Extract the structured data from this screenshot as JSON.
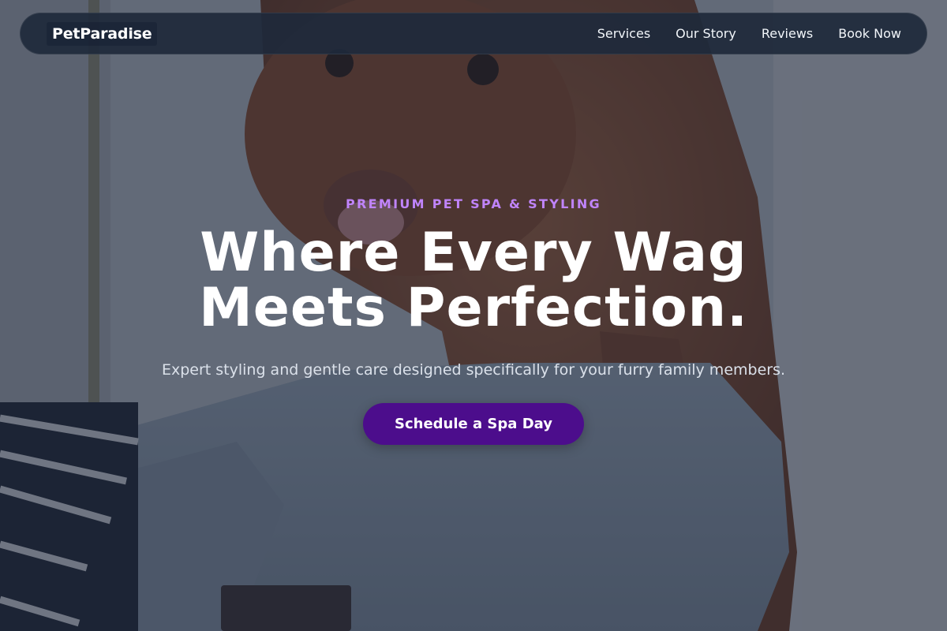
{
  "brand": {
    "name": "PetParadise"
  },
  "nav": {
    "links": [
      {
        "label": "Services"
      },
      {
        "label": "Our Story"
      },
      {
        "label": "Reviews"
      },
      {
        "label": "Book Now"
      }
    ]
  },
  "hero": {
    "eyebrow": "PREMIUM PET SPA & STYLING",
    "headline_line1": "Where Every Wag",
    "headline_line2": "Meets Perfection.",
    "subtext": "Expert styling and gentle care designed specifically for your furry family members.",
    "cta_label": "Schedule a Spa Day"
  },
  "colors": {
    "accent": "#c084fc",
    "cta_background": "#4c0d8c",
    "nav_background": "#1e293b"
  }
}
